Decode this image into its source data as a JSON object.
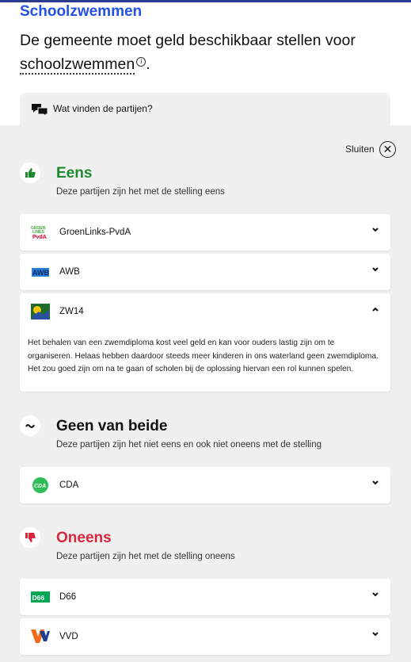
{
  "category": "Schoolzwemmen",
  "statement": {
    "before": "De gemeente moet geld beschikbaar stellen voor ",
    "term": "schoolzwemmen",
    "after": "."
  },
  "tab_label": "Wat vinden de partijen?",
  "close_label": "Sluiten",
  "groups": [
    {
      "title": "Eens",
      "subtitle": "Deze partijen zijn het met de stelling eens",
      "color": "#1e8a2e",
      "icon": "thumbs-up-icon",
      "parties": [
        {
          "name": "GroenLinks-PvdA",
          "logo": "groenlinks-pvda-logo"
        },
        {
          "name": "AWB",
          "logo": "awb-logo"
        },
        {
          "name": "ZW14",
          "logo": "zw14-logo",
          "expanded": true,
          "text": "Het behalen van een zwemdiploma kost veel geld en kan voor ouders lastig zijn om te organiseren. Helaas hebben daardoor steeds meer kinderen in ons waterland geen zwemdiploma. Het zou goed zijn om na te gaan of scholen bij de oplossing hiervan een rol kunnen spelen."
        }
      ]
    },
    {
      "title": "Geen van beide",
      "subtitle": "Deze partijen zijn het niet eens en ook niet oneens met de stelling",
      "color": "#111111",
      "icon": "tilde-icon",
      "parties": [
        {
          "name": "CDA",
          "logo": "cda-logo"
        }
      ]
    },
    {
      "title": "Oneens",
      "subtitle": "Deze partijen zijn het met de stelling oneens",
      "color": "#d7263d",
      "icon": "thumbs-down-icon",
      "parties": [
        {
          "name": "D66",
          "logo": "d66-logo"
        },
        {
          "name": "VVD",
          "logo": "vvd-logo"
        }
      ]
    }
  ],
  "logo_texts": {
    "gl": "GROEN LINKS PvdA",
    "awb": "AWB",
    "cda": "CDA",
    "d66": "D66"
  }
}
